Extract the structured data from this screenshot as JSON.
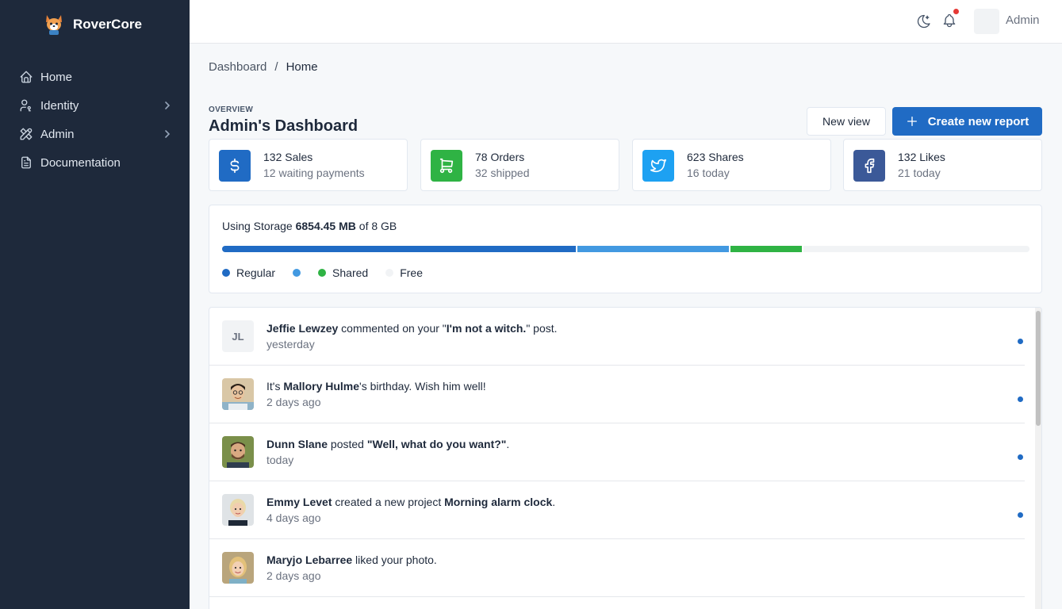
{
  "app": {
    "name": "RoverCore"
  },
  "sidebar": {
    "items": [
      {
        "label": "Home",
        "icon": "home-icon",
        "has_children": false
      },
      {
        "label": "Identity",
        "icon": "user-key-icon",
        "has_children": true
      },
      {
        "label": "Admin",
        "icon": "tools-icon",
        "has_children": true
      },
      {
        "label": "Documentation",
        "icon": "document-icon",
        "has_children": false
      }
    ]
  },
  "topbar": {
    "user_name": "Admin",
    "notifications_unread": true
  },
  "breadcrumb": {
    "parent": "Dashboard",
    "separator": "/",
    "current": "Home"
  },
  "header": {
    "pretitle": "OVERVIEW",
    "title": "Admin's Dashboard",
    "new_view_label": "New view",
    "create_report_label": "Create new report"
  },
  "stats": [
    {
      "primary": "132 Sales",
      "secondary": "12 waiting payments",
      "icon": "dollar-icon",
      "color": "#206bc4"
    },
    {
      "primary": "78 Orders",
      "secondary": "32 shipped",
      "icon": "shopping-cart-icon",
      "color": "#2fb344"
    },
    {
      "primary": "623 Shares",
      "secondary": "16 today",
      "icon": "twitter-icon",
      "color": "#1da1f2"
    },
    {
      "primary": "132 Likes",
      "secondary": "21 today",
      "icon": "facebook-icon",
      "color": "#3b5998"
    }
  ],
  "storage": {
    "prefix": "Using Storage ",
    "used": "6854.45 MB",
    "suffix": " of 8 GB",
    "segments": [
      {
        "label": "Regular",
        "percent": 44,
        "color": "#206bc4"
      },
      {
        "label": "",
        "percent": 19,
        "color": "#4299e1"
      },
      {
        "label": "Shared",
        "percent": 9,
        "color": "#2fb344"
      },
      {
        "label": "Free",
        "percent": 28,
        "color": "#f1f3f5"
      }
    ]
  },
  "feed": [
    {
      "avatar": "JL",
      "parts": [
        [
          "b",
          "Jeffie Lewzey"
        ],
        [
          "t",
          " commented on your \""
        ],
        [
          "b",
          "I'm not a witch."
        ],
        [
          "t",
          "\" post."
        ]
      ],
      "time": "yesterday",
      "unread": true
    },
    {
      "avatar": "photo-1",
      "parts": [
        [
          "t",
          "It's "
        ],
        [
          "b",
          "Mallory Hulme"
        ],
        [
          "t",
          "'s birthday. Wish him well!"
        ]
      ],
      "time": "2 days ago",
      "unread": true
    },
    {
      "avatar": "photo-2",
      "parts": [
        [
          "b",
          "Dunn Slane"
        ],
        [
          "t",
          " posted "
        ],
        [
          "b",
          "\"Well, what do you want?\""
        ],
        [
          "t",
          "."
        ]
      ],
      "time": "today",
      "unread": true
    },
    {
      "avatar": "photo-3",
      "parts": [
        [
          "b",
          "Emmy Levet"
        ],
        [
          "t",
          " created a new project "
        ],
        [
          "b",
          "Morning alarm clock"
        ],
        [
          "t",
          "."
        ]
      ],
      "time": "4 days ago",
      "unread": true
    },
    {
      "avatar": "photo-4",
      "parts": [
        [
          "b",
          "Maryjo Lebarree"
        ],
        [
          "t",
          " liked your photo."
        ]
      ],
      "time": "2 days ago",
      "unread": false
    }
  ]
}
